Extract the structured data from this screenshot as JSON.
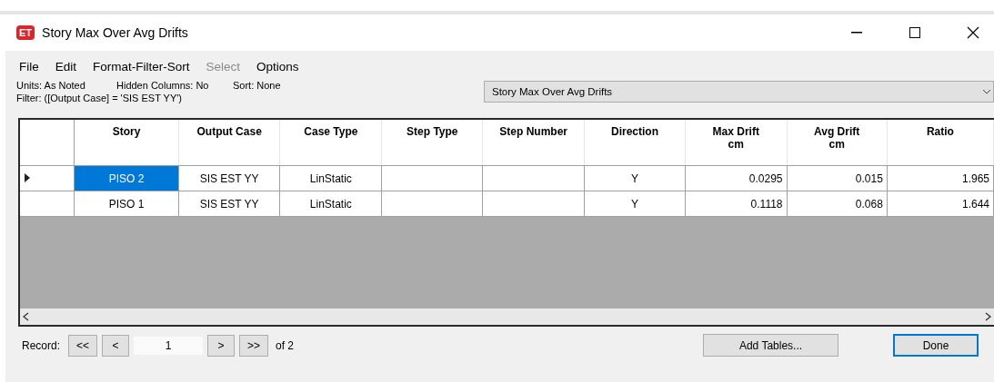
{
  "window": {
    "app_badge": "ET",
    "title": "Story Max Over Avg Drifts"
  },
  "menu": [
    {
      "label": "File",
      "disabled": false
    },
    {
      "label": "Edit",
      "disabled": false
    },
    {
      "label": "Format-Filter-Sort",
      "disabled": false
    },
    {
      "label": "Select",
      "disabled": true
    },
    {
      "label": "Options",
      "disabled": false
    }
  ],
  "info": {
    "units": "Units:  As Noted",
    "hidden_columns": "Hidden Columns:  No",
    "sort": "Sort:  None",
    "filter": "Filter:  ([Output Case] = 'SIS EST YY')"
  },
  "table_select": {
    "value": "Story Max Over Avg Drifts"
  },
  "table": {
    "columns": [
      {
        "title": "Story",
        "kind": "text"
      },
      {
        "title": "Output Case",
        "kind": "text"
      },
      {
        "title": "Case Type",
        "kind": "text"
      },
      {
        "title": "Step Type",
        "kind": "text"
      },
      {
        "title": "Step Number",
        "kind": "text"
      },
      {
        "title": "Direction",
        "kind": "text"
      },
      {
        "title": "Max Drift",
        "unit": "cm",
        "kind": "number"
      },
      {
        "title": "Avg Drift",
        "unit": "cm",
        "kind": "number"
      },
      {
        "title": "Ratio",
        "kind": "number"
      }
    ],
    "rows": [
      {
        "current": true,
        "cells": [
          {
            "text": "PISO 2",
            "selected": true
          },
          {
            "text": "SIS EST YY",
            "selected": false
          },
          {
            "text": "LinStatic",
            "selected": false
          },
          {
            "text": null,
            "selected": false
          },
          {
            "text": null,
            "selected": false
          },
          {
            "text": "Y",
            "selected": false
          },
          {
            "text": "0.0295",
            "selected": false
          },
          {
            "text": "0.015",
            "selected": false
          },
          {
            "text": "1.965",
            "selected": false
          }
        ]
      },
      {
        "current": false,
        "cells": [
          {
            "text": "PISO 1",
            "selected": false
          },
          {
            "text": "SIS EST YY",
            "selected": false
          },
          {
            "text": "LinStatic",
            "selected": false
          },
          {
            "text": null,
            "selected": false
          },
          {
            "text": null,
            "selected": false
          },
          {
            "text": "Y",
            "selected": false
          },
          {
            "text": "0.1118",
            "selected": false
          },
          {
            "text": "0.068",
            "selected": false
          },
          {
            "text": "1.644",
            "selected": false
          }
        ]
      }
    ]
  },
  "footer": {
    "record_label": "Record:",
    "first": "<<",
    "prev": "<",
    "record": "1",
    "next": ">",
    "last": ">>",
    "of": "of 2",
    "add_tables": "Add Tables...",
    "done": "Done"
  }
}
